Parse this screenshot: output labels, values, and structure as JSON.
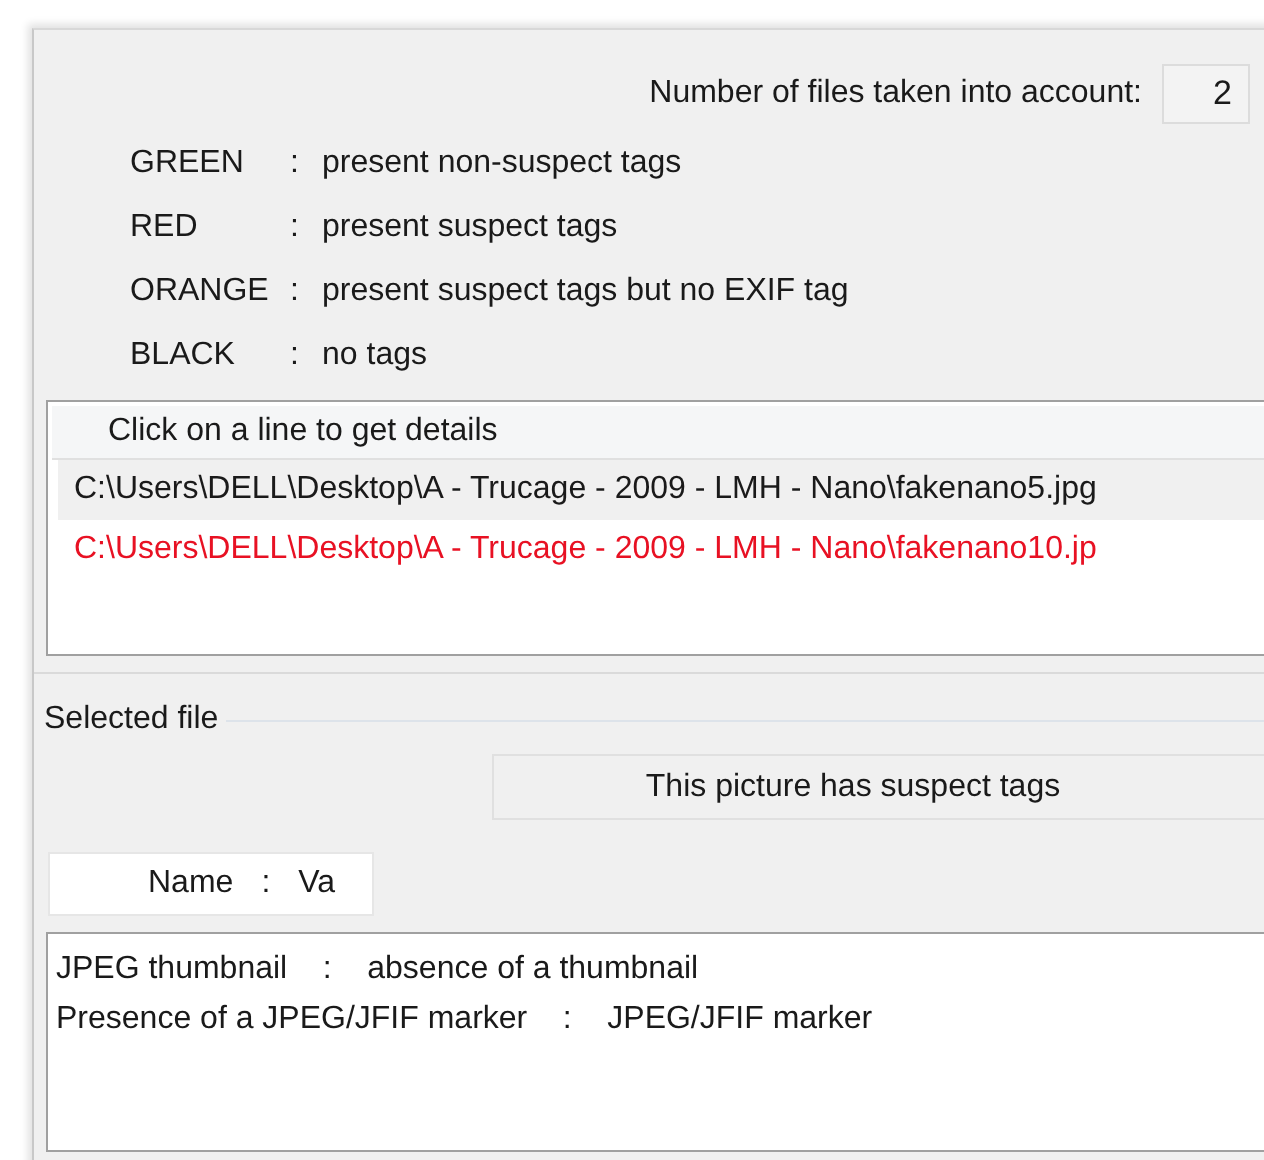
{
  "file_count": {
    "label": "Number of files taken into account:",
    "value": "2"
  },
  "legend": [
    {
      "name": "GREEN",
      "separator": ":",
      "description": "present non-suspect tags"
    },
    {
      "name": "RED",
      "separator": ":",
      "description": "present suspect tags"
    },
    {
      "name": "ORANGE",
      "separator": ":",
      "description": "present suspect tags but no EXIF tag"
    },
    {
      "name": "BLACK",
      "separator": ":",
      "description": "no tags"
    }
  ],
  "file_list": {
    "header": "Click on a line to get details",
    "rows": [
      {
        "path": "C:\\Users\\DELL\\Desktop\\A - Trucage - 2009 - LMH - Nano\\fakenano5.jpg",
        "color": "#1a1a1a",
        "selected": true
      },
      {
        "path": "C:\\Users\\DELL\\Desktop\\A - Trucage - 2009 - LMH - Nano\\fakenano10.jp",
        "color": "#e81123",
        "selected": false
      }
    ]
  },
  "selected_file": {
    "title": "Selected file",
    "status": "This picture has suspect tags",
    "details_header": {
      "name": "Name",
      "separator": ":",
      "value": "Va"
    },
    "details": [
      {
        "name": "JPEG thumbnail",
        "separator": ":",
        "value": "absence of a thumbnail"
      },
      {
        "name": "Presence of a JPEG/JFIF marker",
        "separator": ":",
        "value": "JPEG/JFIF marker"
      }
    ]
  }
}
